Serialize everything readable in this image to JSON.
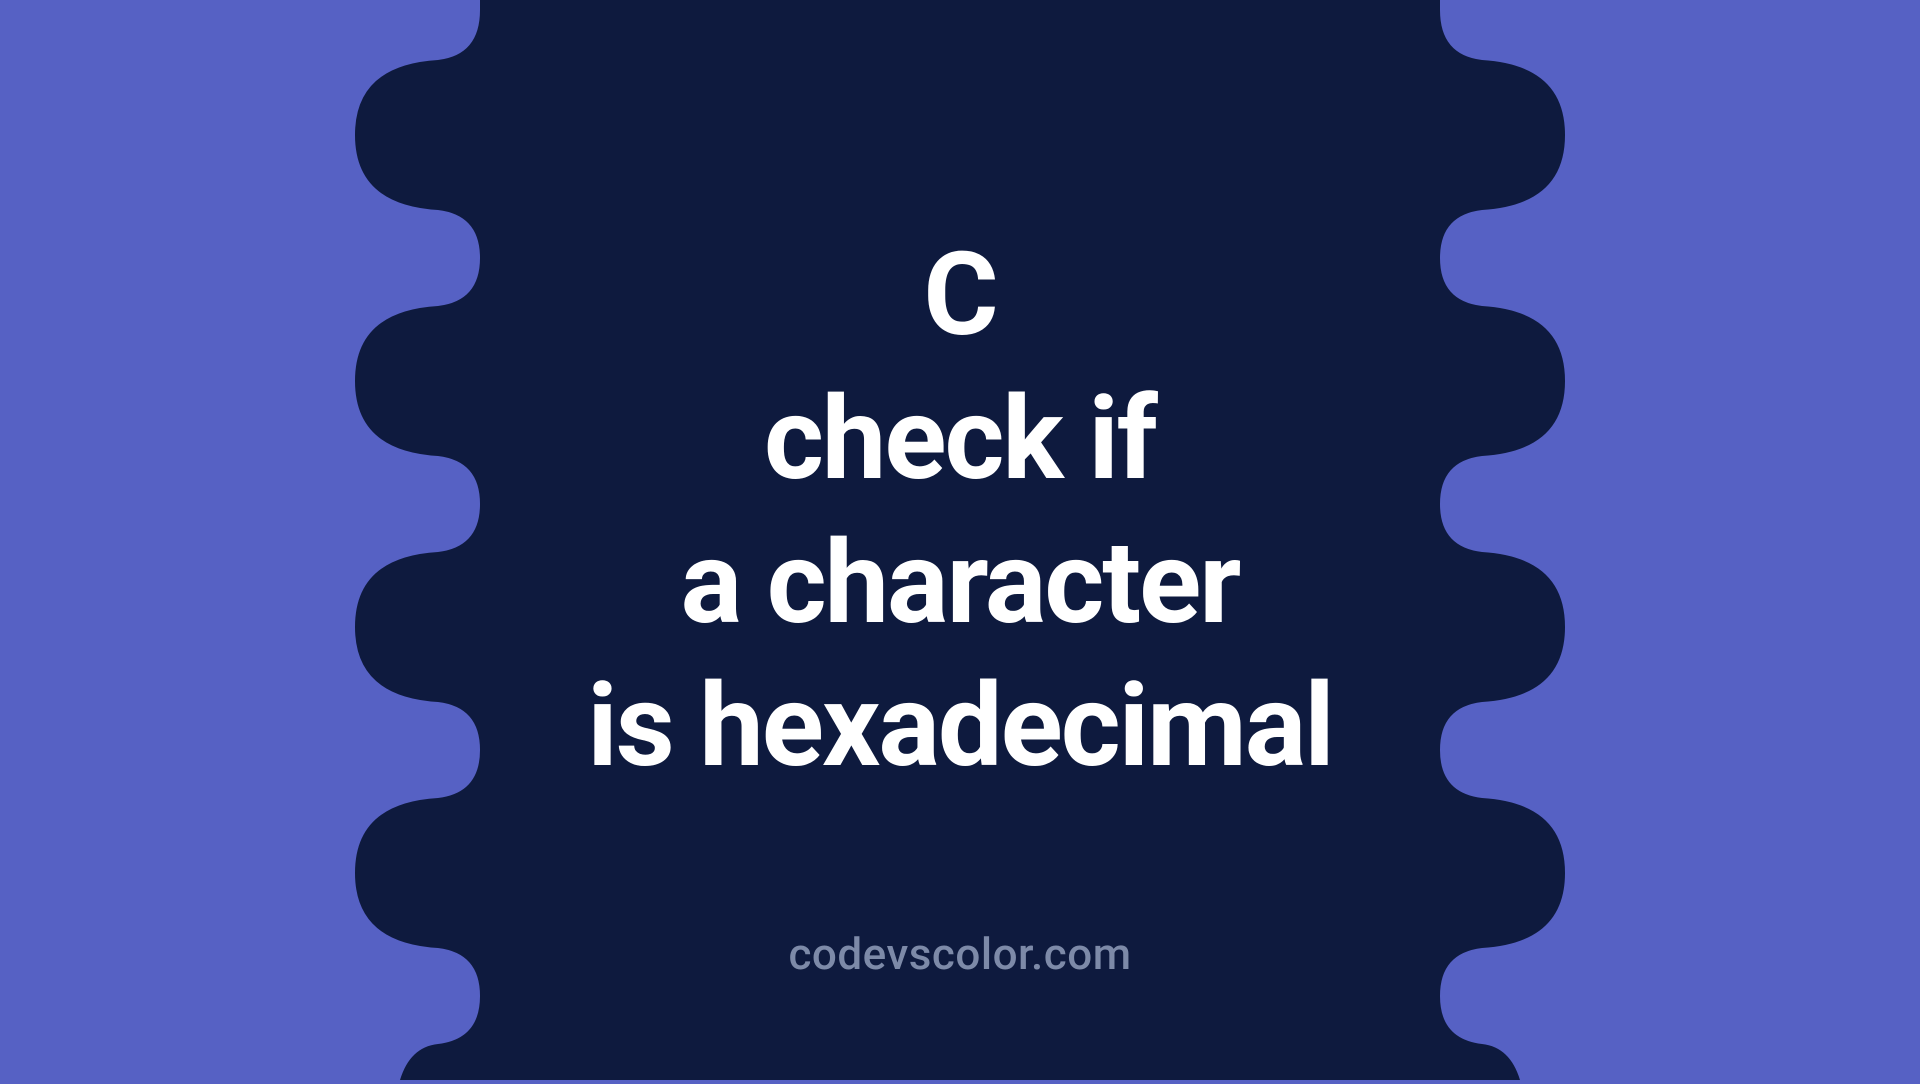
{
  "title": {
    "line1": "C",
    "line2": "check if",
    "line3": "a character",
    "line4": "is hexadecimal"
  },
  "watermark": "codevscolor.com",
  "colors": {
    "background": "#5661c4",
    "blob": "#0e1a3e",
    "text": "#ffffff",
    "watermark": "#7d8aa8"
  }
}
